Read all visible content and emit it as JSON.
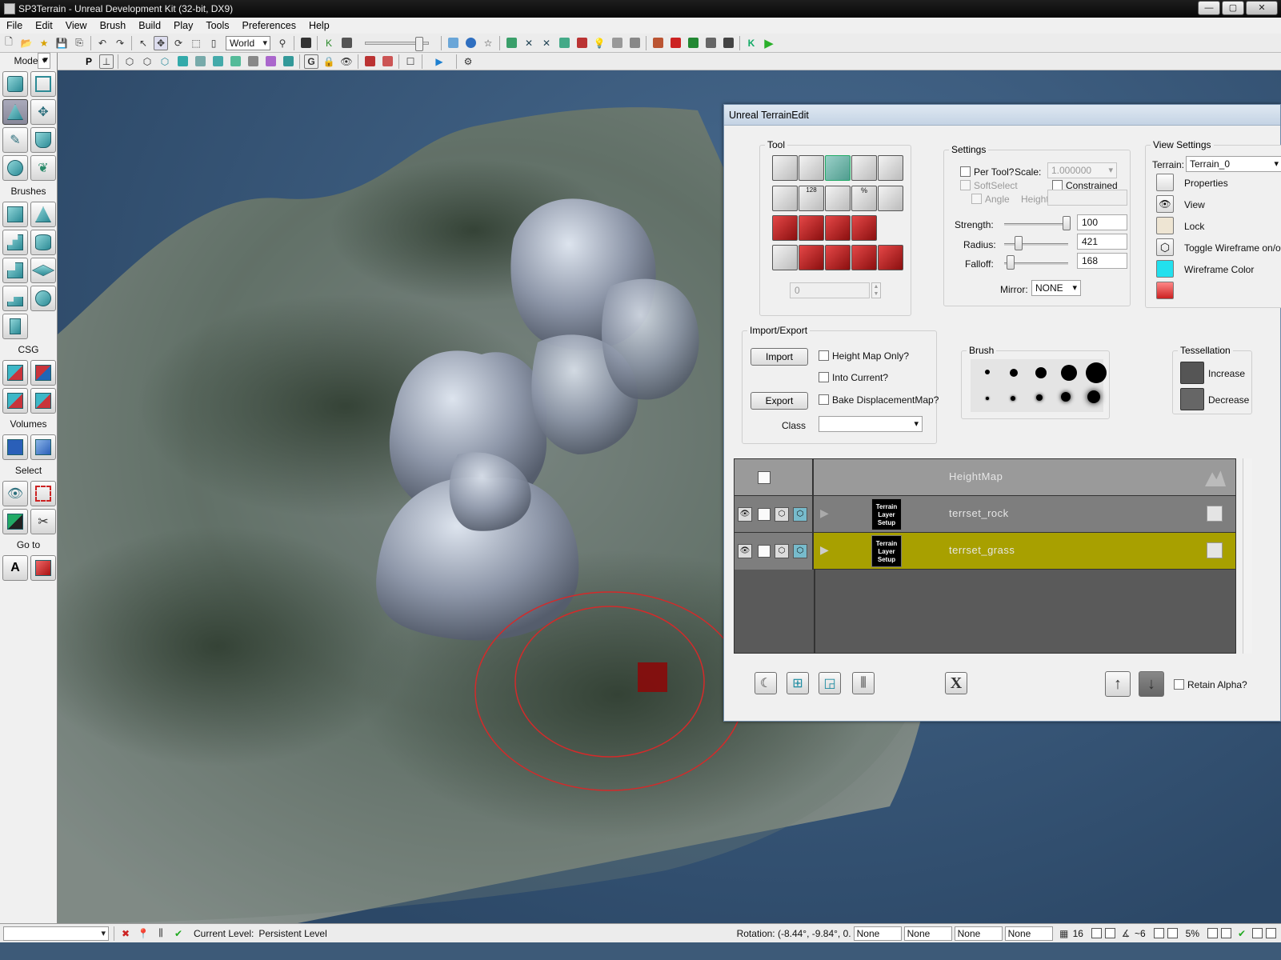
{
  "window": {
    "title": "SP3Terrain - Unreal Development Kit (32-bit, DX9)",
    "buttons": [
      "—",
      "▢",
      "✕"
    ]
  },
  "menu": [
    "File",
    "Edit",
    "View",
    "Brush",
    "Build",
    "Play",
    "Tools",
    "Preferences",
    "Help"
  ],
  "toolbar": {
    "coord_system": "World"
  },
  "modes_panel": {
    "header": "Modes",
    "sections": {
      "brushes": "Brushes",
      "csg": "CSG",
      "volumes": "Volumes",
      "select": "Select",
      "goto": "Go to"
    }
  },
  "terrain_edit": {
    "title": "Unreal TerrainEdit",
    "tool": {
      "label": "Tool",
      "value": "0",
      "icon_badges": [
        "128",
        "%"
      ]
    },
    "settings": {
      "label": "Settings",
      "per_tool": "Per Tool?",
      "scale_label": "Scale:",
      "scale_value": "1.000000",
      "soft_select": "SoftSelect",
      "constrained": "Constrained",
      "angle": "Angle",
      "height": "Height",
      "strength_label": "Strength:",
      "strength_value": "100",
      "radius_label": "Radius:",
      "radius_value": "421",
      "falloff_label": "Falloff:",
      "falloff_value": "168",
      "mirror_label": "Mirror:",
      "mirror_value": "NONE",
      "strength_fraction": 0.97,
      "radius_fraction": 0.22,
      "falloff_fraction": 0.1
    },
    "view_settings": {
      "label": "View Settings",
      "terrain_label": "Terrain:",
      "terrain_value": "Terrain_0",
      "properties": "Properties",
      "view": "View",
      "lock": "Lock",
      "toggle_wireframe": "Toggle Wireframe on/off",
      "wireframe_color": "Wireframe Color",
      "wireframe_color_hex": "#22e0ee"
    },
    "import_export": {
      "label": "Import/Export",
      "import_button": "Import",
      "export_button": "Export",
      "height_map_only": "Height Map Only?",
      "into_current": "Into Current?",
      "bake_displacement": "Bake DisplacementMap?",
      "class_label": "Class"
    },
    "brush": {
      "label": "Brush"
    },
    "tessellation": {
      "label": "Tessellation",
      "increase": "Increase",
      "decrease": "Decrease"
    },
    "layers": [
      {
        "name": "HeightMap"
      },
      {
        "name": "terrset_rock",
        "thumb": "Terrain Layer Setup"
      },
      {
        "name": "terrset_grass",
        "thumb": "Terrain Layer Setup",
        "selected": true,
        "highlight_hex": "#a8a000"
      }
    ],
    "bottom": {
      "close_glyph": "X",
      "retain_alpha": "Retain Alpha?"
    }
  },
  "status": {
    "current_level_label": "Current Level:",
    "current_level_value": "Persistent Level",
    "rotation": "Rotation: (-8.44°, -9.84°, 0.",
    "fields": [
      "None",
      "None",
      "None",
      "None"
    ],
    "grid": "16",
    "snap": "~6",
    "scale": "5%"
  }
}
